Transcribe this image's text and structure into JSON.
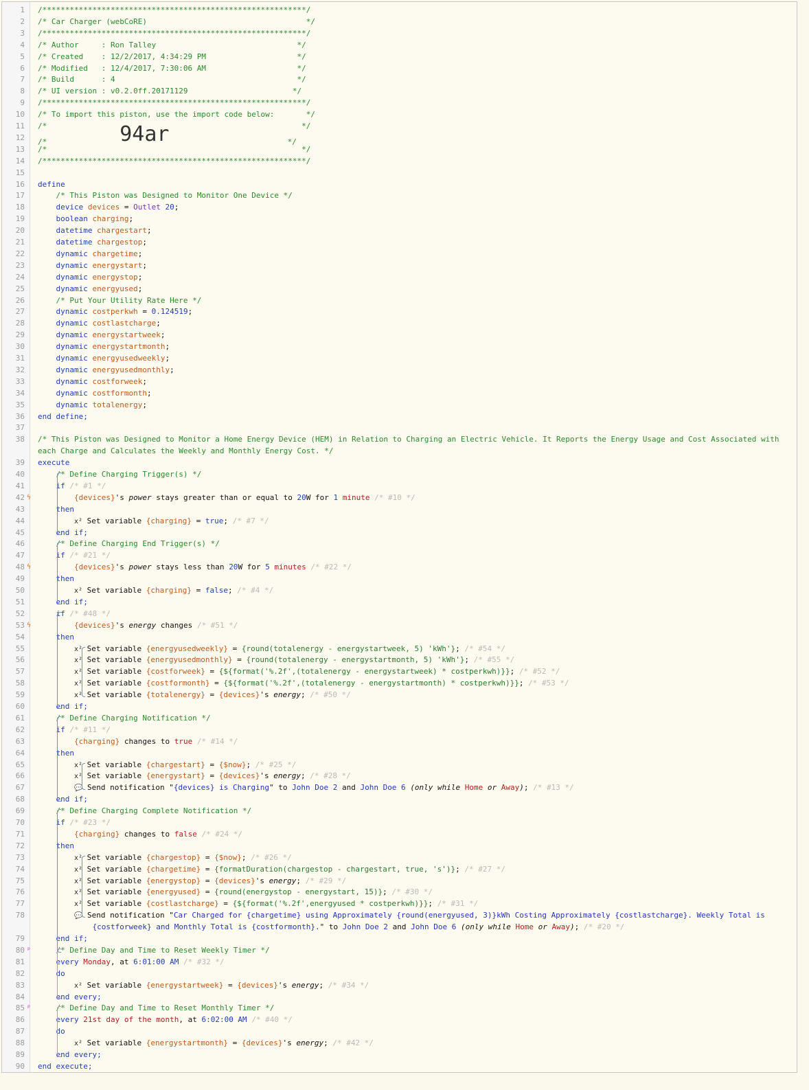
{
  "header": {
    "border": "/**********************************************************/",
    "title": "/* Car Charger (webCoRE)                                   */",
    "author": "/* Author     : Ron Talley                               */",
    "created": "/* Created    : 12/2/2017, 4:34:29 PM                    */",
    "modified": "/* Modified   : 12/4/2017, 7:30:06 AM                    */",
    "build": "/* Build      : 4                                        */",
    "ui_version": "/* UI version : v0.2.0ff.20171129                       */",
    "import_note": "/* To import this piston, use the import code below:       */",
    "blank": "/*                                                        */",
    "import_code": "94ar"
  },
  "define": {
    "open": "define",
    "comment1": "/* This Piston was Designed to Monitor One Device */",
    "devices": {
      "type": "device",
      "name": "devices",
      "value": "Outlet 20"
    },
    "vars": [
      {
        "type": "boolean",
        "name": "charging"
      },
      {
        "type": "datetime",
        "name": "chargestart"
      },
      {
        "type": "datetime",
        "name": "chargestop"
      },
      {
        "type": "dynamic",
        "name": "chargetime"
      },
      {
        "type": "dynamic",
        "name": "energystart"
      },
      {
        "type": "dynamic",
        "name": "energystop"
      },
      {
        "type": "dynamic",
        "name": "energyused"
      }
    ],
    "comment2": "/* Put Your Utility Rate Here */",
    "costperkwh": {
      "type": "dynamic",
      "name": "costperkwh",
      "value": "0.124519"
    },
    "vars2": [
      {
        "type": "dynamic",
        "name": "costlastcharge"
      },
      {
        "type": "dynamic",
        "name": "energystartweek"
      },
      {
        "type": "dynamic",
        "name": "energystartmonth"
      },
      {
        "type": "dynamic",
        "name": "energyusedweekly"
      },
      {
        "type": "dynamic",
        "name": "energyusedmonthly"
      },
      {
        "type": "dynamic",
        "name": "costforweek"
      },
      {
        "type": "dynamic",
        "name": "costformonth"
      },
      {
        "type": "dynamic",
        "name": "totalenergy"
      }
    ],
    "close": "end define;"
  },
  "execute_comment_line1": "/* This Piston was Designed to Monitor a Home Energy Device (HEM) in Relation to Charging an Electric Vehicle. It Reports the Energy Usage and Cost Associated with",
  "execute_comment_line2": "each Charge and Calculates the Weekly and Monthly Energy Cost. */",
  "execute_open": "execute",
  "execute_close": "end execute;",
  "line_numbers_total": 90
}
